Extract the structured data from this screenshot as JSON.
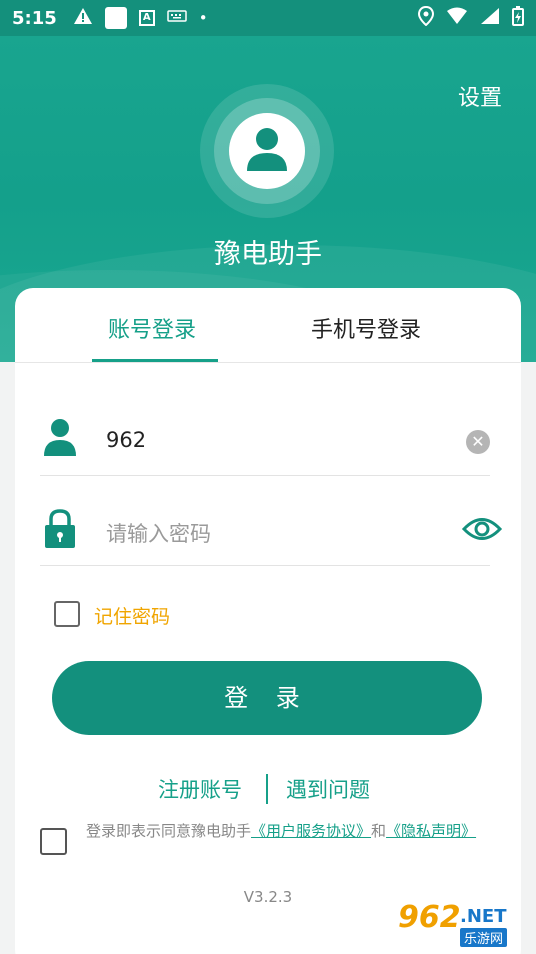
{
  "status_bar": {
    "time": "5:15"
  },
  "header": {
    "settings_label": "设置",
    "app_name": "豫电助手"
  },
  "tabs": {
    "account_login": "账号登录",
    "phone_login": "手机号登录",
    "active": "account_login"
  },
  "form": {
    "username_value": "962",
    "password_placeholder": "请输入密码",
    "remember_label": "记住密码",
    "remember_checked": false,
    "login_button": "登 录"
  },
  "links": {
    "register": "注册账号",
    "problem": "遇到问题"
  },
  "agreement": {
    "prefix": "登录即表示同意豫电助手",
    "user_agreement": "《用户服务协议》",
    "and": "和",
    "privacy": "《隐私声明》",
    "checked": false
  },
  "version": "V3.2.3",
  "watermark": {
    "number": "962",
    "net": ".NET",
    "sub": "乐游网"
  },
  "colors": {
    "primary": "#16a089",
    "button": "#13907d",
    "remember_text": "#f0a500"
  }
}
